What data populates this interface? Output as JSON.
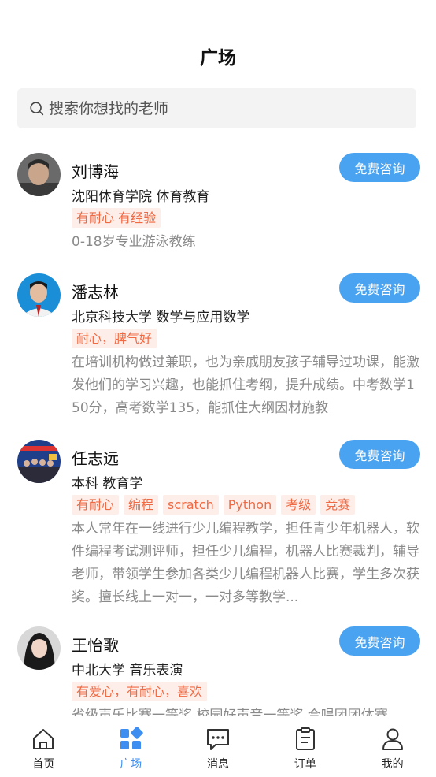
{
  "header": {
    "title": "广场"
  },
  "search": {
    "placeholder": "搜索你想找的老师",
    "icon": "search-icon"
  },
  "consult_label": "免费咨询",
  "teachers": [
    {
      "name": "刘博海",
      "school": "沈阳体育学院 体育教育",
      "tags": [
        "有耐心 有经验"
      ],
      "desc": "0-18岁专业游泳教练"
    },
    {
      "name": "潘志林",
      "school": "北京科技大学 数学与应用数学",
      "tags": [
        "耐心，脾气好"
      ],
      "desc": "在培训机构做过兼职，也为亲戚朋友孩子辅导过功课，能激发他们的学习兴趣，也能抓住考纲，提升成绩。中考数学150分，高考数学135，能抓住大纲因材施教"
    },
    {
      "name": "任志远",
      "school": "本科 教育学",
      "tags": [
        "有耐心",
        "编程",
        "scratch",
        "Python",
        "考级",
        "竞赛"
      ],
      "desc": "本人常年在一线进行少儿编程教学，担任青少年机器人，软件编程考试测评师，担任少儿编程，机器人比赛裁判，辅导老师，带领学生参加各类少儿编程机器人比赛，学生多次获奖。擅长线上一对一，一对多等教学..."
    },
    {
      "name": "王怡歌",
      "school": "中北大学 音乐表演",
      "tags": [
        "有爱心，有耐心，喜欢"
      ],
      "desc": "省级声乐比赛一等奖 校园好声音一等奖 合唱团团体赛"
    }
  ],
  "tabbar": [
    {
      "label": "首页",
      "icon": "home-icon"
    },
    {
      "label": "广场",
      "icon": "square-grid-icon"
    },
    {
      "label": "消息",
      "icon": "message-icon"
    },
    {
      "label": "订单",
      "icon": "order-icon"
    },
    {
      "label": "我的",
      "icon": "user-icon"
    }
  ],
  "colors": {
    "accent": "#4aa3f0",
    "tag_text": "#ef6a43",
    "tag_bg": "#fdeeea",
    "active_tab": "#3d8ef0"
  }
}
